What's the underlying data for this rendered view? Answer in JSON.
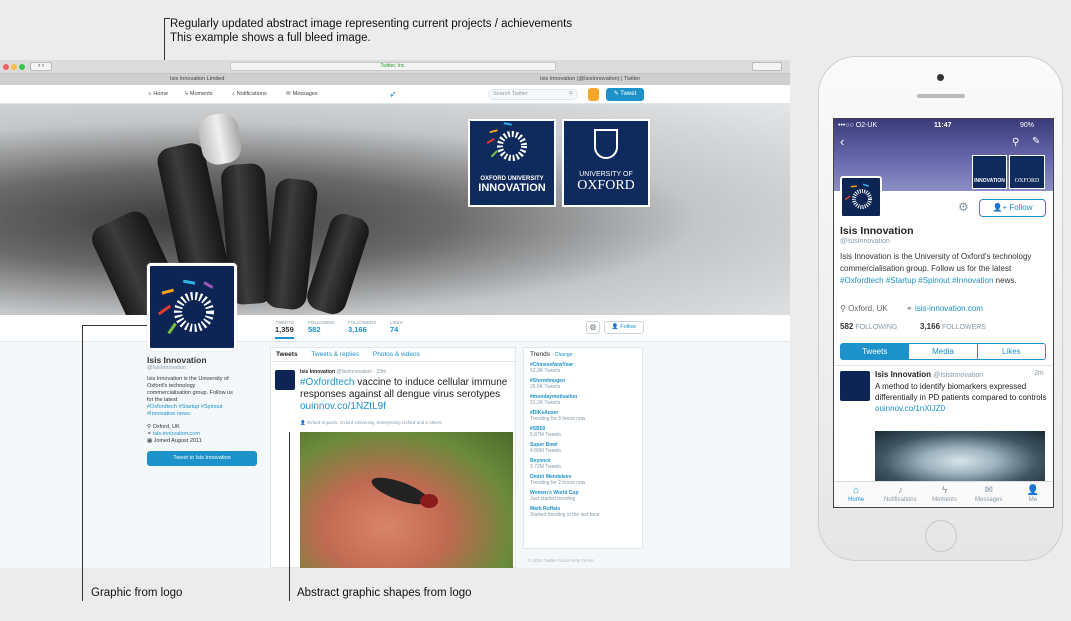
{
  "annotations": {
    "top_line1": "Regularly updated abstract image representing current projects / achievements",
    "top_line2": "This example shows a full bleed image.",
    "bottom_left": "Graphic from logo",
    "bottom_mid": "Abstract graphic shapes from logo"
  },
  "browser": {
    "url": "Twitter, Inc.",
    "tab_left": "Isis Innovation Limited",
    "tab_right": "Isis Innovation (@IsisInnovation) | Twitter",
    "nav": {
      "home": "Home",
      "moments": "Moments",
      "notifications": "Notifications",
      "messages": "Messages"
    },
    "search_placeholder": "Search Twitter",
    "tweet_button": "Tweet"
  },
  "header_logos": {
    "oui_line1": "OXFORD UNIVERSITY",
    "oui_line2": "INNOVATION",
    "uo_line1": "UNIVERSITY OF",
    "uo_line2": "OXFORD"
  },
  "stats": [
    {
      "label": "TWEETS",
      "value": "1,359"
    },
    {
      "label": "FOLLOWING",
      "value": "582"
    },
    {
      "label": "FOLLOWERS",
      "value": "3,166"
    },
    {
      "label": "LIKES",
      "value": "74"
    }
  ],
  "follow_label": "Follow",
  "profile": {
    "name": "Isis Innovation",
    "handle": "@IsisInnovation",
    "bio": "Isis Innovation is the University of Oxford's technology commercialisation group. Follow us for the latest",
    "hashtags": "#Oxfordtech #Startup #Spinout #Innovation news.",
    "location": "Oxford, UK",
    "website": "isis-innovation.com",
    "joined": "Joined August 2011",
    "tweet_to": "Tweet to Isis Innovation"
  },
  "timeline": {
    "tabs": [
      "Tweets",
      "Tweets & replies",
      "Photos & videos"
    ],
    "tweet_name": "Isis Innovation",
    "tweet_meta": "@IsisInnovation · 23m",
    "tweet_hashtag": "#Oxfordtech",
    "tweet_text": "vaccine to induce cellular immune responses against all dengue virus serotypes",
    "tweet_link": "ouinnov.co/1NZtL9f",
    "tweet_context": "Oxford Impacts, Oxford University, Enterprising Oxford and 2 others"
  },
  "trends": {
    "title": "Trends",
    "change": "· Change",
    "items": [
      {
        "tag": "#ChineseNewYear",
        "meta": "52.3K Tweets"
      },
      {
        "tag": "#StormImogen",
        "meta": "26.5K Tweets"
      },
      {
        "tag": "#mondaymotivation",
        "meta": "21.2K Tweets"
      },
      {
        "tag": "#DIKeAnser",
        "meta": "Trending for 3 hours now"
      },
      {
        "tag": "#SB50",
        "meta": "5.87M Tweets"
      },
      {
        "tag": "Super Bowl",
        "meta": "4.88M Tweets"
      },
      {
        "tag": "Beyoncé",
        "meta": "3.72M Tweets"
      },
      {
        "tag": "Dmitri Mendeleev",
        "meta": "Trending for 2 hours now"
      },
      {
        "tag": "Women's World Cup",
        "meta": "Just started trending"
      },
      {
        "tag": "Mark Ruffalo",
        "meta": "Started trending in the last hour"
      }
    ],
    "footer": "© 2016 Twitter   About   Help   Terms"
  },
  "phone": {
    "carrier": "•••○○ O2-UK",
    "time": "11:47",
    "battery": "90%",
    "follow": "Follow",
    "name": "Isis Innovation",
    "handle": "@IsisInnovation",
    "bio": "Isis Innovation is the University of Oxford's technology commercialisation group. Follow us for the latest",
    "hashtags": "#Oxfordtech #Startup #Spinout #Innovation",
    "bio_end": "news.",
    "location": "Oxford, UK",
    "website": "isis-innovation.com",
    "following": "582",
    "following_label": "FOLLOWING",
    "followers": "3,166",
    "followers_label": "FOLLOWERS",
    "tabs": [
      "Tweets",
      "Media",
      "Likes"
    ],
    "tweet_name": "Isis Innovation",
    "tweet_handle": "@IsisInnovation",
    "tweet_time": "2m",
    "tweet_text": "A method to identify biomarkers expressed differentially in PD patients compared to controls",
    "tweet_link": "ouinnov.co/1nXIJZ0",
    "tabbar": [
      "Home",
      "Notifications",
      "Moments",
      "Messages",
      "Me"
    ]
  },
  "colors": {
    "twitter_blue": "#1d91c9",
    "oxford_navy": "#0f2a5c"
  }
}
